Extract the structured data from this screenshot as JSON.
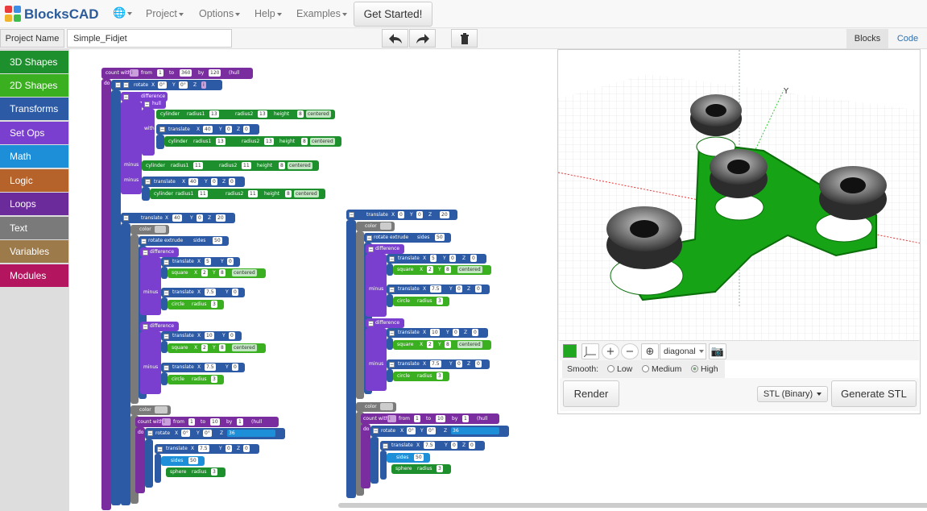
{
  "app": {
    "title": "BlocksCAD"
  },
  "nav": {
    "project": "Project",
    "options": "Options",
    "help": "Help",
    "examples": "Examples",
    "get_started": "Get Started!"
  },
  "toolbar": {
    "project_name_label": "Project Name",
    "project_name_value": "Simple_Fidjet",
    "tab_blocks": "Blocks",
    "tab_code": "Code"
  },
  "categories": [
    {
      "label": "3D Shapes",
      "color": "#1d8f2c"
    },
    {
      "label": "2D Shapes",
      "color": "#3aaf1f"
    },
    {
      "label": "Transforms",
      "color": "#2d5aa5"
    },
    {
      "label": "Set Ops",
      "color": "#7b3fcf"
    },
    {
      "label": "Math",
      "color": "#1c8fd8"
    },
    {
      "label": "Logic",
      "color": "#b5622b"
    },
    {
      "label": "Loops",
      "color": "#6b2b9b"
    },
    {
      "label": "Text",
      "color": "#7a7a7a"
    },
    {
      "label": "Variables",
      "color": "#9c7a4a"
    },
    {
      "label": "Modules",
      "color": "#b3165f"
    }
  ],
  "blocks": {
    "count_with": "count with",
    "from": "from",
    "to": "to",
    "by": "by",
    "hull": "(hull",
    "do": "do",
    "rotate": "rotate",
    "translate": "translate",
    "difference": "difference",
    "minus": "minus",
    "with": "with",
    "hull_label": "hull",
    "cylinder": "cylinder",
    "radius1": "radius1",
    "radius2": "radius2",
    "height": "height",
    "centered": "centered",
    "color": "color",
    "rotate_extrude": "rotate extrude",
    "sides": "sides",
    "square": "square",
    "circle": "circle",
    "radius": "radius",
    "sphere": "sphere",
    "x": "X",
    "y": "Y",
    "z": "Z",
    "v0": "0",
    "v0deg": "0°",
    "v1": "1",
    "v360": "360",
    "v120": "120",
    "v40": "40",
    "v13": "13",
    "v8": "8",
    "v11": "11",
    "v20": "20",
    "v50": "50",
    "v5": "5",
    "v2": "2",
    "v7_5": "7.5",
    "v3": "3",
    "v10": "10",
    "v36": "36",
    "i_var": "i"
  },
  "viewer": {
    "view_select": "diagonal",
    "smooth_label": "Smooth:",
    "smooth_low": "Low",
    "smooth_medium": "Medium",
    "smooth_high": "High",
    "render": "Render",
    "format": "STL (Binary)",
    "generate": "Generate STL"
  }
}
